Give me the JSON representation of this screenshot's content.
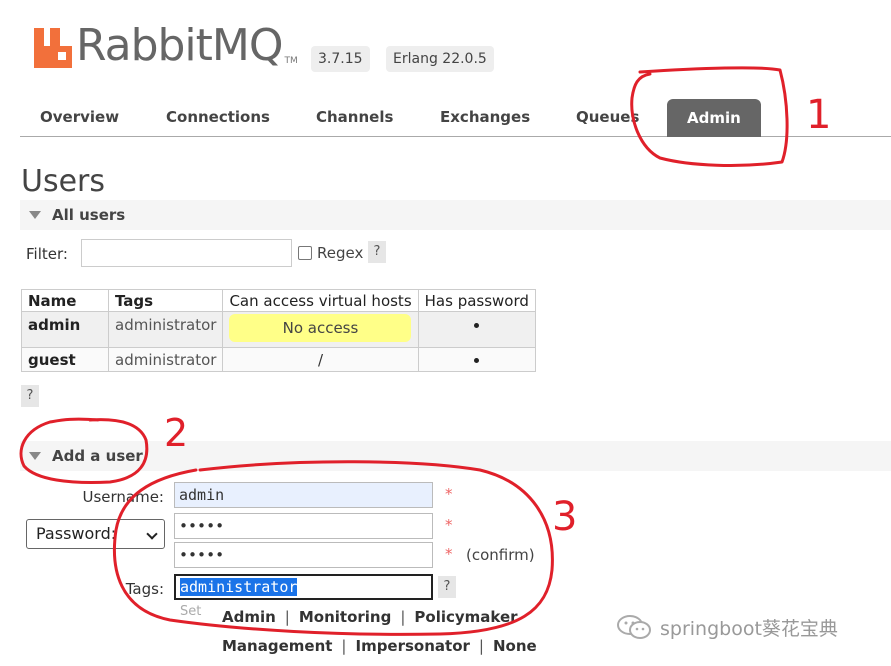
{
  "brand": {
    "name": "RabbitMQ",
    "tm": "TM",
    "color": "#f2703b"
  },
  "versions": {
    "rabbitmq": "3.7.15",
    "erlang": "Erlang 22.0.5"
  },
  "tabs": [
    {
      "label": "Overview"
    },
    {
      "label": "Connections"
    },
    {
      "label": "Channels"
    },
    {
      "label": "Exchanges"
    },
    {
      "label": "Queues"
    },
    {
      "label": "Admin",
      "active": true
    }
  ],
  "page_title": "Users",
  "all_users": {
    "title": "All users",
    "filter_label": "Filter:",
    "filter_value": "",
    "regex_label": "Regex",
    "help": "?",
    "columns": [
      "Name",
      "Tags",
      "Can access virtual hosts",
      "Has password"
    ],
    "rows": [
      {
        "name": "admin",
        "tags": "administrator",
        "vhosts": "No access",
        "has_password": "•"
      },
      {
        "name": "guest",
        "tags": "administrator",
        "vhosts": "/",
        "has_password": "•"
      }
    ],
    "table_help": "?"
  },
  "add_user": {
    "title": "Add a user",
    "username_label": "Username:",
    "username_value": "admin",
    "password_select": "Password:",
    "password_value": "•••••",
    "confirm_value": "•••••",
    "confirm_label": "(confirm)",
    "required_mark": "*",
    "tags_label": "Tags:",
    "tags_value": "administrator",
    "tags_help": "?",
    "set_label": "Set",
    "tag_options_row1": [
      "Admin",
      "Monitoring",
      "Policymaker"
    ],
    "tag_options_row2": [
      "Management",
      "Impersonator",
      "None"
    ],
    "separator": "|"
  },
  "annotations": {
    "color": "#e0202a",
    "labels": [
      "1",
      "2",
      "3"
    ]
  },
  "watermark": {
    "text": "springboot葵花宝典"
  }
}
